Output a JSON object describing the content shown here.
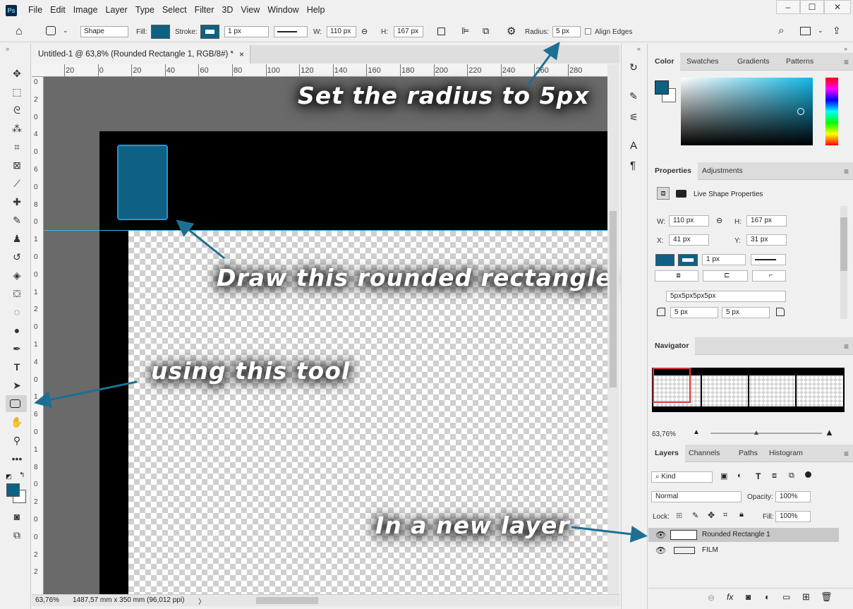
{
  "app": {
    "logo": "Ps",
    "menu": [
      "File",
      "Edit",
      "Image",
      "Layer",
      "Type",
      "Select",
      "Filter",
      "3D",
      "View",
      "Window",
      "Help"
    ],
    "window_controls": [
      "–",
      "☐",
      "✕"
    ]
  },
  "options": {
    "mode": "Shape",
    "fill_label": "Fill:",
    "stroke_label": "Stroke:",
    "stroke_width": "1 px",
    "w_label": "W:",
    "w_value": "110 px",
    "h_label": "H:",
    "h_value": "167 px",
    "radius_label": "Radius:",
    "radius_value": "5 px",
    "align_edges": "Align Edges"
  },
  "document": {
    "tab_title": "Untitled-1 @ 63,8% (Rounded Rectangle 1, RGB/8#) *",
    "close": "×",
    "zoom": "63,76%",
    "size_info": "1487,57 mm x 350 mm (96,012 ppi)",
    "ruler_h": [
      "20",
      "0",
      "20",
      "40",
      "60",
      "80",
      "100",
      "120",
      "140",
      "160",
      "180",
      "200",
      "220",
      "240",
      "260",
      "280"
    ],
    "ruler_v": [
      "0",
      "2",
      "0",
      "4",
      "0",
      "6",
      "0",
      "8",
      "0",
      "1",
      "0",
      "0",
      "1",
      "2",
      "0",
      "1",
      "4",
      "0",
      "1",
      "6",
      "0",
      "1",
      "8",
      "0",
      "2",
      "0",
      "0",
      "2",
      "2"
    ]
  },
  "annotations": {
    "radius": "Set the radius to 5px",
    "draw": "Draw this rounded rectangle",
    "tool": "using this tool",
    "layer": "In a new layer"
  },
  "color_panel": {
    "tabs": [
      "Color",
      "Swatches",
      "Gradients",
      "Patterns"
    ],
    "foreground": "#0f6184"
  },
  "properties_panel": {
    "tabs": [
      "Properties",
      "Adjustments"
    ],
    "subtitle": "Live Shape Properties",
    "w_label": "W:",
    "w_value": "110 px",
    "h_label": "H:",
    "h_value": "167 px",
    "x_label": "X:",
    "x_value": "41 px",
    "y_label": "Y:",
    "y_value": "31 px",
    "stroke_width": "1 px",
    "radii": "5px5px5px5px",
    "radius_tl": "5 px",
    "radius_tr": "5 px"
  },
  "navigator_panel": {
    "tab": "Navigator",
    "zoom": "63,76%"
  },
  "layers_panel": {
    "tabs": [
      "Layers",
      "Channels",
      "Paths",
      "Histogram"
    ],
    "filter": "Kind",
    "blend": "Normal",
    "opacity_label": "Opacity:",
    "opacity": "100%",
    "lock_label": "Lock:",
    "fill_label": "Fill:",
    "fill": "100%",
    "layers": [
      {
        "name": "Rounded Rectangle 1",
        "selected": true
      },
      {
        "name": "FILM",
        "selected": false
      }
    ]
  },
  "colors": {
    "accent": "#0f6184",
    "arrow": "#1d6f93"
  }
}
